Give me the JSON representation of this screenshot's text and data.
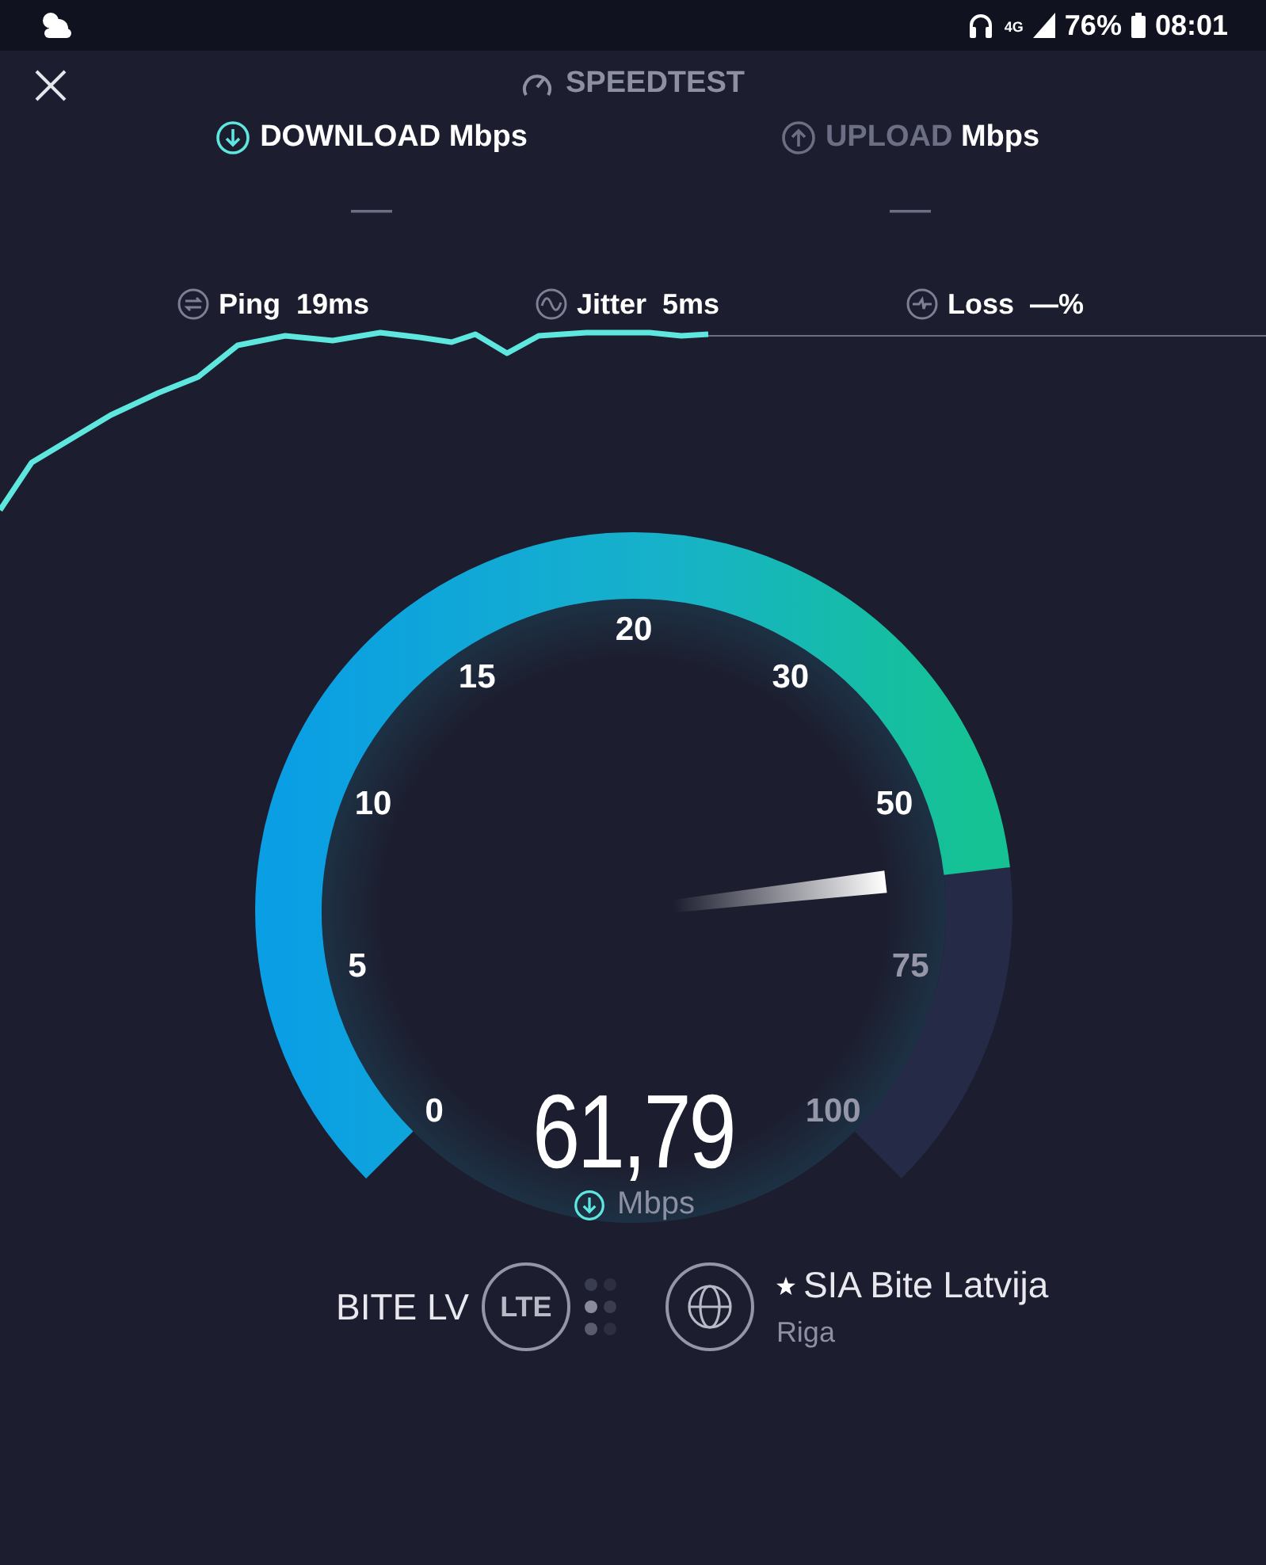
{
  "status_bar": {
    "network": "4G",
    "battery": "76%",
    "time": "08:01"
  },
  "header": {
    "title": "SPEEDTEST"
  },
  "tabs": [
    {
      "kind": "download",
      "label": "DOWNLOAD",
      "unit": "Mbps",
      "value": "—",
      "selected": true
    },
    {
      "kind": "upload",
      "label": "UPLOAD",
      "unit": "Mbps",
      "value": "—",
      "selected": false
    }
  ],
  "metrics": [
    {
      "kind": "ping",
      "label": "Ping",
      "value": "19ms"
    },
    {
      "kind": "jitter",
      "label": "Jitter",
      "value": "5ms"
    },
    {
      "kind": "loss",
      "label": "Loss",
      "value": "—%"
    }
  ],
  "gauge": {
    "ticks": [
      "0",
      "5",
      "10",
      "15",
      "20",
      "30",
      "50",
      "75",
      "100"
    ],
    "reading": "61,79",
    "unit": "Mbps"
  },
  "provider": {
    "isp": "BITE LV",
    "network": "LTE",
    "server": "SIA Bite Latvija",
    "starred": true,
    "location": "Riga"
  }
}
